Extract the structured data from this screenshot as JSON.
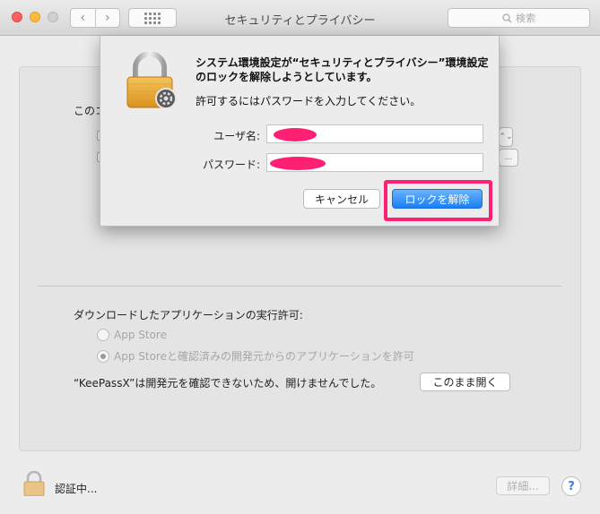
{
  "window": {
    "title": "セキュリティとプライバシー"
  },
  "toolbar": {
    "back_glyph": "‹",
    "forward_glyph": "›"
  },
  "search": {
    "placeholder": "検索"
  },
  "general": {
    "prefs_label_partial": "このコ",
    "download_label": "ダウンロードしたアプリケーションの実行許可:",
    "options": [
      "App Store",
      "App Storeと確認済みの開発元からのアプリケーションを許可"
    ],
    "selected_option": 1,
    "blocked_message": "“KeePassX”は開発元を確認できないため、開けませんでした。",
    "open_anyway": "このまま開く",
    "ghost_stepper": "⌃⌄",
    "ghost_ellipsis": "..."
  },
  "footer": {
    "status": "認証中...",
    "details": "詳細...",
    "help": "?"
  },
  "auth_sheet": {
    "message_bold": "システム環境設定が“セキュリティとプライバシー”環境設定のロックを解除しようとしています。",
    "message": "許可するにはパスワードを入力してください。",
    "username_label": "ユーザ名:",
    "username_value": "",
    "password_label": "パスワード:",
    "password_value": "",
    "cancel": "キャンセル",
    "unlock": "ロックを解除"
  },
  "colors": {
    "accent": "#197ff5",
    "highlight": "#ff1f73",
    "close": "#fc605c",
    "minimize": "#fdbc40"
  }
}
